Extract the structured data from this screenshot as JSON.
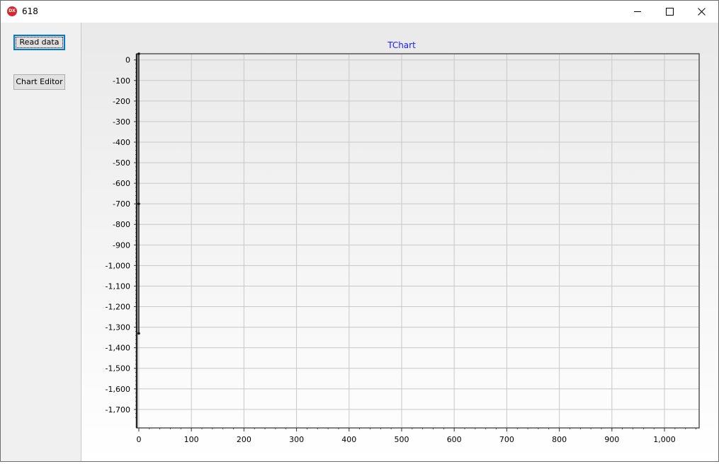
{
  "window": {
    "title": "618",
    "app_icon_text": "DX",
    "icons": {
      "app": "dx-app-icon",
      "minimize": "minimize-icon",
      "maximize": "maximize-icon",
      "close": "close-icon"
    }
  },
  "left_panel": {
    "read_data_label": "Read data",
    "chart_editor_label": "Chart Editor"
  },
  "colors": {
    "title": "#1a1aff",
    "grid": "#c8c8c8",
    "axis": "#333333",
    "focus": "#0078d7"
  },
  "chart_data": {
    "type": "line",
    "title": "TChart",
    "xlabel": "",
    "ylabel": "",
    "xlim": [
      -4,
      1066
    ],
    "ylim": [
      -1790,
      30
    ],
    "x_ticks": [
      0,
      100,
      200,
      300,
      400,
      500,
      600,
      700,
      800,
      900,
      1000
    ],
    "x_tick_labels": [
      "0",
      "100",
      "200",
      "300",
      "400",
      "500",
      "600",
      "700",
      "800",
      "900",
      "1,000"
    ],
    "y_ticks": [
      0,
      -100,
      -200,
      -300,
      -400,
      -500,
      -600,
      -700,
      -800,
      -900,
      -1000,
      -1100,
      -1200,
      -1300,
      -1400,
      -1500,
      -1600,
      -1700
    ],
    "y_tick_labels": [
      "0",
      "-100",
      "-200",
      "-300",
      "-400",
      "-500",
      "-600",
      "-700",
      "-800",
      "-900",
      "-1,000",
      "-1,100",
      "-1,200",
      "-1,300",
      "-1,400",
      "-1,500",
      "-1,600",
      "-1,700"
    ],
    "grid": true,
    "series": [
      {
        "x": [
          0,
          0,
          0
        ],
        "y": [
          30,
          -700,
          -1330
        ]
      }
    ]
  }
}
